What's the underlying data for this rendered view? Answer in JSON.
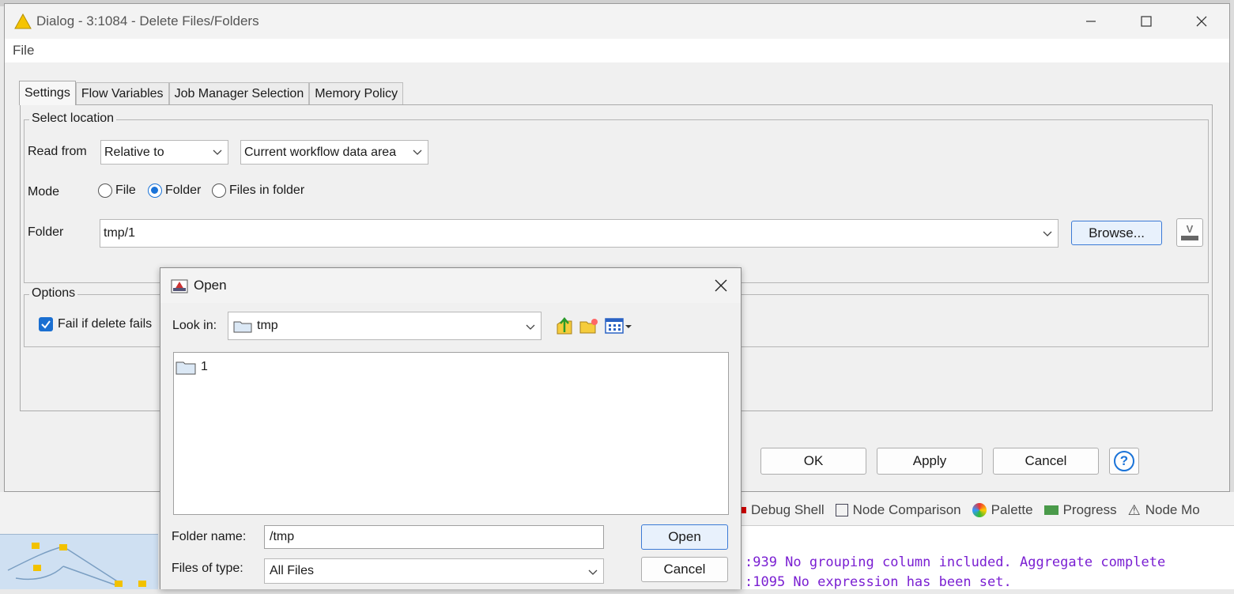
{
  "background": {
    "bottom_tabs": [
      {
        "label": "Debug Shell",
        "icon": "debug-icon"
      },
      {
        "label": "Node Comparison",
        "icon": "window-icon"
      },
      {
        "label": "Palette",
        "icon": "palette-icon"
      },
      {
        "label": "Progress",
        "icon": "progress-icon"
      },
      {
        "label": "Node Mo",
        "icon": "node-monitor-icon"
      }
    ],
    "console_lines": [
      ":939 No grouping column included. Aggregate complete",
      ":1095 No expression has been set."
    ]
  },
  "dialog": {
    "title": "Dialog - 3:1084 - Delete Files/Folders",
    "menu": [
      "File"
    ],
    "tabs": [
      "Settings",
      "Flow Variables",
      "Job Manager Selection",
      "Memory Policy"
    ],
    "select_location": {
      "group_title": "Select location",
      "read_from_label": "Read from",
      "read_from_value": "Relative to",
      "read_from_scope": "Current workflow data area",
      "mode_label": "Mode",
      "mode_options": [
        "File",
        "Folder",
        "Files in folder"
      ],
      "mode_selected": "Folder",
      "folder_label": "Folder",
      "folder_value": "tmp/1",
      "browse_label": "Browse...",
      "flow_var_label": "V"
    },
    "options": {
      "group_title": "Options",
      "fail_if_delete_fails_label": "Fail if delete fails",
      "fail_if_delete_fails_checked": true
    },
    "buttons": {
      "ok": "OK",
      "apply": "Apply",
      "cancel": "Cancel",
      "help": "?"
    }
  },
  "open_dialog": {
    "title": "Open",
    "look_in_label": "Look in:",
    "look_in_value": "tmp",
    "files": [
      {
        "name": "1",
        "type": "folder"
      }
    ],
    "folder_name_label": "Folder name:",
    "folder_name_value": "/tmp",
    "files_of_type_label": "Files of type:",
    "files_of_type_value": "All Files",
    "open_button": "Open",
    "cancel_button": "Cancel"
  }
}
